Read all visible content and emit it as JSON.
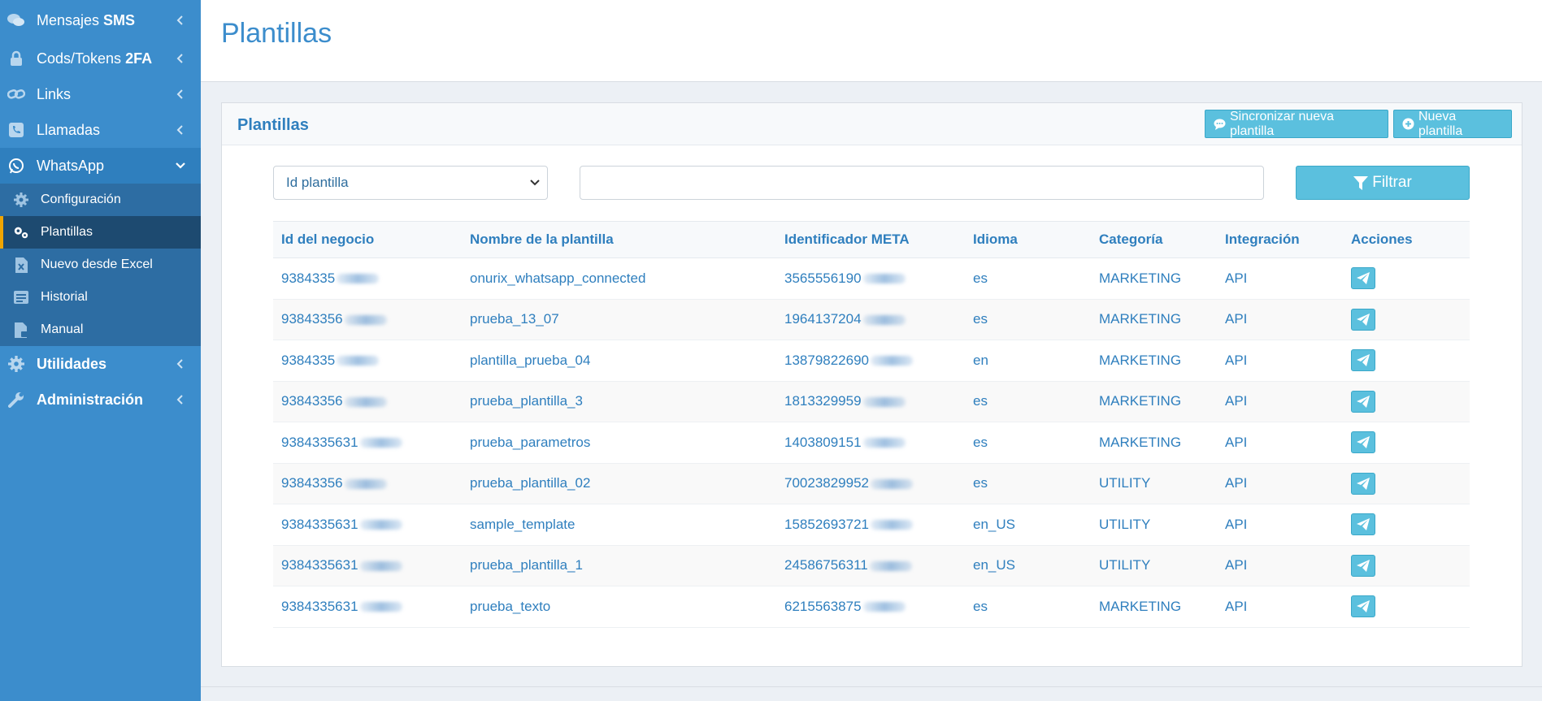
{
  "sidebar": {
    "items": [
      {
        "label_pre": "Mensajes ",
        "label_bold": "SMS",
        "icon": "comments-icon"
      },
      {
        "label_pre": "Cods/Tokens ",
        "label_bold": "2FA",
        "icon": "lock-icon"
      },
      {
        "label_pre": "Links",
        "label_bold": "",
        "icon": "link-icon"
      },
      {
        "label_pre": "Llamadas",
        "label_bold": "",
        "icon": "phone-icon"
      },
      {
        "label_pre": "WhatsApp",
        "label_bold": "",
        "icon": "whatsapp-icon"
      }
    ],
    "whatsapp_submenu": [
      {
        "label": "Configuración",
        "icon": "gear-icon"
      },
      {
        "label": "Plantillas",
        "icon": "gears-icon"
      },
      {
        "label": "Nuevo desde Excel",
        "icon": "excel-file-icon"
      },
      {
        "label": "Historial",
        "icon": "history-icon"
      },
      {
        "label": "Manual",
        "icon": "manual-file-icon"
      }
    ],
    "utilidades": "Utilidades",
    "administracion": "Administración"
  },
  "header": {
    "title": "Plantillas"
  },
  "card": {
    "title": "Plantillas",
    "sync_button": "Sincronizar nueva plantilla",
    "new_button": "Nueva plantilla"
  },
  "filter": {
    "select_value": "Id plantilla",
    "input_value": "",
    "button": "Filtrar"
  },
  "table": {
    "columns": [
      "Id del negocio",
      "Nombre de la plantilla",
      "Identificador META",
      "Idioma",
      "Categoría",
      "Integración",
      "Acciones"
    ],
    "rows": [
      {
        "business_id": "9384335",
        "name": "onurix_whatsapp_connected",
        "meta_id": "3565556190",
        "lang": "es",
        "category": "MARKETING",
        "integration": "API"
      },
      {
        "business_id": "93843356",
        "name": "prueba_13_07",
        "meta_id": "1964137204",
        "lang": "es",
        "category": "MARKETING",
        "integration": "API"
      },
      {
        "business_id": "9384335",
        "name": "plantilla_prueba_04",
        "meta_id": "13879822690",
        "lang": "en",
        "category": "MARKETING",
        "integration": "API"
      },
      {
        "business_id": "93843356",
        "name": "prueba_plantilla_3",
        "meta_id": "1813329959",
        "lang": "es",
        "category": "MARKETING",
        "integration": "API"
      },
      {
        "business_id": "9384335631",
        "name": "prueba_parametros",
        "meta_id": "1403809151",
        "lang": "es",
        "category": "MARKETING",
        "integration": "API"
      },
      {
        "business_id": "93843356",
        "name": "prueba_plantilla_02",
        "meta_id": "70023829952",
        "lang": "es",
        "category": "UTILITY",
        "integration": "API"
      },
      {
        "business_id": "9384335631",
        "name": "sample_template",
        "meta_id": "15852693721",
        "lang": "en_US",
        "category": "UTILITY",
        "integration": "API"
      },
      {
        "business_id": "9384335631",
        "name": "prueba_plantilla_1",
        "meta_id": "24586756311",
        "lang": "en_US",
        "category": "UTILITY",
        "integration": "API"
      },
      {
        "business_id": "9384335631",
        "name": "prueba_texto",
        "meta_id": "6215563875",
        "lang": "es",
        "category": "MARKETING",
        "integration": "API"
      }
    ]
  },
  "colors": {
    "sidebar_bg": "#3c8dcc",
    "submenu_bg": "#2d6da3",
    "active_bg": "#1d4a70",
    "accent": "#5bc0de",
    "text_blue": "#2f7fbe",
    "active_marker": "#f0a500"
  }
}
